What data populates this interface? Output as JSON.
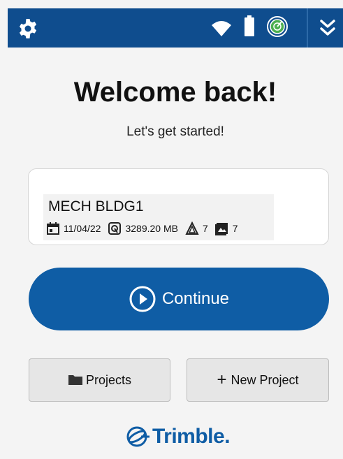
{
  "header": {
    "icons": [
      "gear-icon",
      "wifi-icon",
      "battery-icon",
      "gnss-status-icon",
      "chevrons-down-icon"
    ],
    "bar_color": "#0f4d8e"
  },
  "welcome": {
    "title": "Welcome back!",
    "subtitle": "Let's get started!"
  },
  "project": {
    "name": "MECH BLDG1",
    "date": "11/04/22",
    "size": "3289.20 MB",
    "scans": "7",
    "images": "7"
  },
  "actions": {
    "continue_label": "Continue",
    "projects_label": "Projects",
    "new_project_label": "New Project",
    "new_project_prefix": "+"
  },
  "footer": {
    "logo_text": "Trimble."
  },
  "colors": {
    "primary": "#0f5da5",
    "background": "#f4f4f4"
  }
}
